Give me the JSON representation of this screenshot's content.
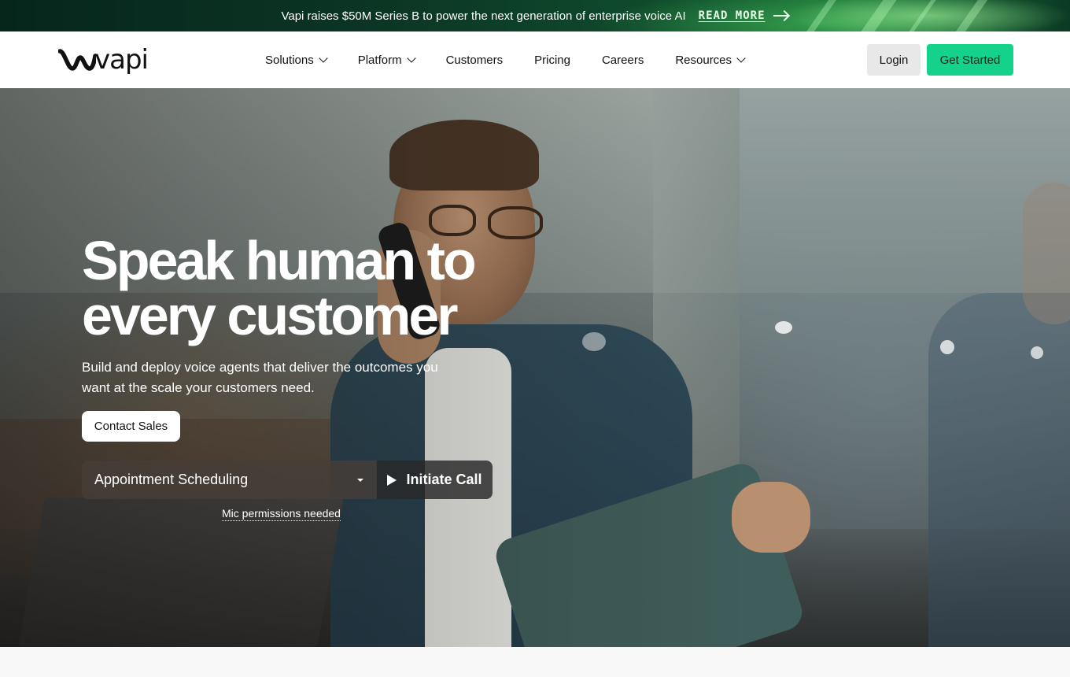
{
  "banner": {
    "text": "Vapi raises $50M Series B to power the next generation of enterprise voice AI",
    "link_label": "READ MORE",
    "link_icon": "arrow-right-icon"
  },
  "header": {
    "logo_text": "vapi",
    "logo_icon": "vapi-wave-icon",
    "nav": [
      {
        "label": "Solutions",
        "has_dropdown": true
      },
      {
        "label": "Platform",
        "has_dropdown": true
      },
      {
        "label": "Customers",
        "has_dropdown": false
      },
      {
        "label": "Pricing",
        "has_dropdown": false
      },
      {
        "label": "Careers",
        "has_dropdown": false
      },
      {
        "label": "Resources",
        "has_dropdown": true
      }
    ],
    "login_label": "Login",
    "cta_label": "Get Started"
  },
  "hero": {
    "title_line1": "Speak human to",
    "title_line2": "every customer",
    "subtitle_line1": "Build and deploy voice agents that deliver the outcomes you",
    "subtitle_line2": "want at the scale your customers need.",
    "contact_label": "Contact Sales",
    "demo_select_value": "Appointment Scheduling",
    "call_label": "Initiate Call",
    "mic_note": "Mic permissions needed",
    "background_image": "man-on-phone-holding-tablet-photo"
  },
  "colors": {
    "accent": "#14d28a",
    "banner_bg": "#0b3524",
    "header_bg": "#ffffff",
    "login_bg": "#e8e8e8"
  }
}
